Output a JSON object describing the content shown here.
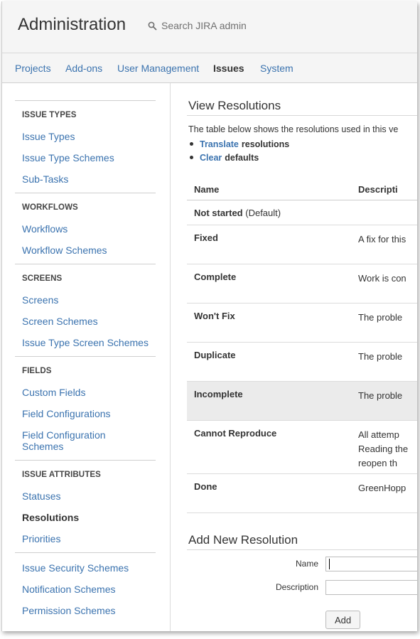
{
  "header": {
    "title": "Administration",
    "search_placeholder": "Search JIRA admin"
  },
  "topnav": {
    "items": [
      "Projects",
      "Add-ons",
      "User Management",
      "Issues",
      "System"
    ],
    "active": "Issues"
  },
  "sidebar": {
    "sections": [
      {
        "heading": "ISSUE TYPES",
        "links": [
          "Issue Types",
          "Issue Type Schemes",
          "Sub-Tasks"
        ]
      },
      {
        "heading": "WORKFLOWS",
        "links": [
          "Workflows",
          "Workflow Schemes"
        ]
      },
      {
        "heading": "SCREENS",
        "links": [
          "Screens",
          "Screen Schemes",
          "Issue Type Screen Schemes"
        ]
      },
      {
        "heading": "FIELDS",
        "links": [
          "Custom Fields",
          "Field Configurations",
          "Field Configuration Schemes"
        ]
      },
      {
        "heading": "ISSUE ATTRIBUTES",
        "links": [
          "Statuses",
          "Resolutions",
          "Priorities"
        ]
      },
      {
        "heading": "",
        "links": [
          "Issue Security Schemes",
          "Notification Schemes",
          "Permission Schemes"
        ]
      }
    ],
    "current": "Resolutions"
  },
  "main": {
    "title": "View Resolutions",
    "intro": "The table below shows the resolutions used in this ve",
    "bullets": [
      {
        "link": "Translate",
        "text": "resolutions"
      },
      {
        "link": "Clear",
        "text": "defaults"
      }
    ],
    "table": {
      "headers": [
        "Name",
        "Descripti"
      ],
      "rows": [
        {
          "name": "Not started",
          "suffix": "(Default)",
          "desc": []
        },
        {
          "name": "Fixed",
          "suffix": "",
          "desc": [
            "A fix for this"
          ]
        },
        {
          "name": "Complete",
          "suffix": "",
          "desc": [
            "Work is con"
          ]
        },
        {
          "name": "Won't Fix",
          "suffix": "",
          "desc": [
            "The proble"
          ]
        },
        {
          "name": "Duplicate",
          "suffix": "",
          "desc": [
            "The proble"
          ]
        },
        {
          "name": "Incomplete",
          "suffix": "",
          "desc": [
            "The proble"
          ]
        },
        {
          "name": "Cannot Reproduce",
          "suffix": "",
          "desc": [
            "All attemp",
            "Reading the",
            "reopen th"
          ]
        },
        {
          "name": "Done",
          "suffix": "",
          "desc": [
            "GreenHopp"
          ]
        }
      ],
      "highlighted": "Incomplete"
    },
    "add_form": {
      "title": "Add New Resolution",
      "name_label": "Name",
      "name_value": "",
      "description_label": "Description",
      "description_value": "",
      "add_label": "Add"
    }
  },
  "colors": {
    "link": "#3b73af",
    "header_bg": "#f5f5f5",
    "highlight_row": "#ebebeb",
    "text": "#333333"
  },
  "icons": [
    "search-icon"
  ]
}
